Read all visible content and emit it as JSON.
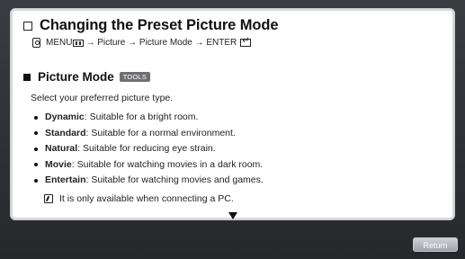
{
  "panel": {
    "title": "Changing the Preset Picture Mode",
    "menu_label": "MENU",
    "path": "→ Picture → Picture Mode → ENTER"
  },
  "section": {
    "title": "Picture Mode",
    "tools_label": "TOOLS",
    "description": "Select your preferred picture type.",
    "items": [
      {
        "name": "Dynamic",
        "text": ": Suitable for a bright room."
      },
      {
        "name": "Standard",
        "text": ": Suitable for a normal environment."
      },
      {
        "name": "Natural",
        "text": ": Suitable for reducing eye strain."
      },
      {
        "name": "Movie",
        "text": ": Suitable for watching movies in a dark room."
      },
      {
        "name": "Entertain",
        "text": ": Suitable for watching movies and games."
      }
    ],
    "note": "It is only available when connecting a PC."
  },
  "footer": {
    "return_label": "Return"
  },
  "icons": {
    "checkbox": "checkbox-icon",
    "remote": "remote-icon",
    "menu": "menu-icon",
    "enter": "enter-icon",
    "note": "note-icon",
    "scroll_down": "scroll-down-icon"
  }
}
